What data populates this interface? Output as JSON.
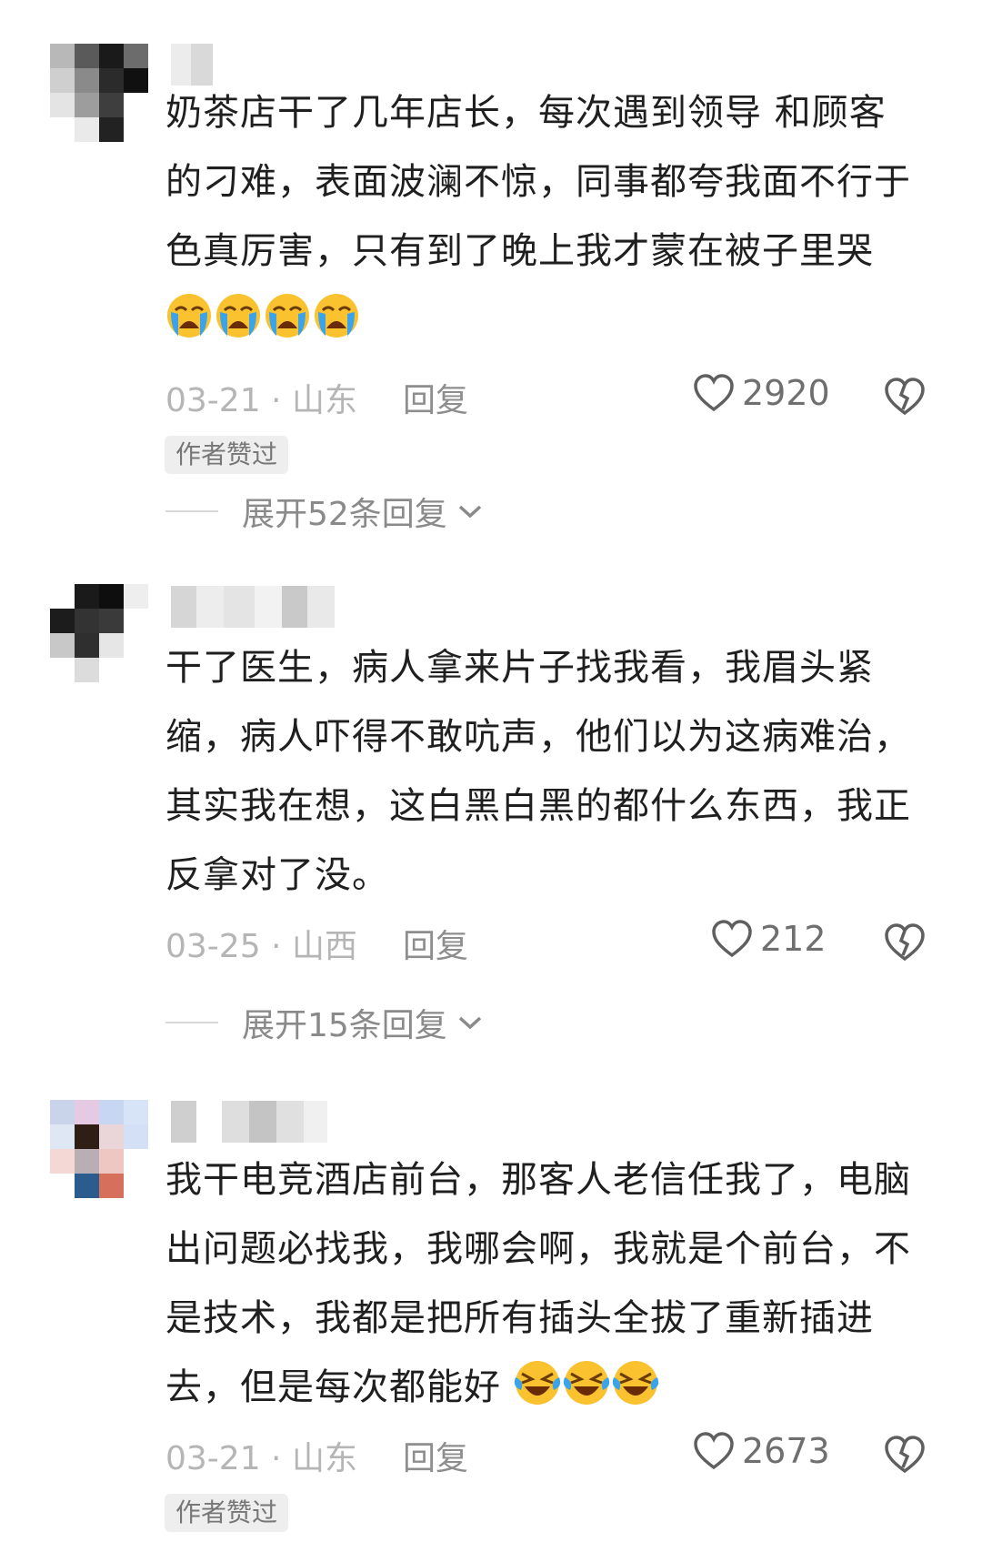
{
  "comments": [
    {
      "text": "奶茶店干了几年店长，每次遇到领导 和顾客的刁难，表面波澜不惊，同事都夸我面不行于色真厉害，只有到了晚上我才蒙在被子里哭",
      "emoji_count": 4,
      "emoji_type": "crying-face-icon",
      "date": "03-21 · 山东",
      "reply_label": "回复",
      "likes": "2920",
      "badge": "作者赞过",
      "expand_label": "展开52条回复"
    },
    {
      "text": "干了医生，病人拿来片子找我看，我眉头紧缩，病人吓得不敢吭声，他们以为这病难治，其实我在想，这白黑白黑的都什么东西，我正反拿对了没。",
      "date": "03-25 · 山西",
      "reply_label": "回复",
      "likes": "212",
      "expand_label": "展开15条回复"
    },
    {
      "text": "我干电竞酒店前台，那客人老信任我了，电脑出问题必找我，我哪会啊，我就是个前台，不是技术，我都是把所有插头全拔了重新插进去，但是每次都能好",
      "emoji_count": 3,
      "emoji_type": "laughing-crying-face-icon",
      "date": "03-21 · 山东",
      "reply_label": "回复",
      "likes": "2673",
      "badge": "作者赞过"
    }
  ],
  "colors": {
    "text": "#1f1f1f",
    "meta": "#a3a3a3",
    "badge_bg": "#eeeeee",
    "emoji_yellow": "#f9c22e",
    "tear_blue": "#3ba3ea"
  }
}
